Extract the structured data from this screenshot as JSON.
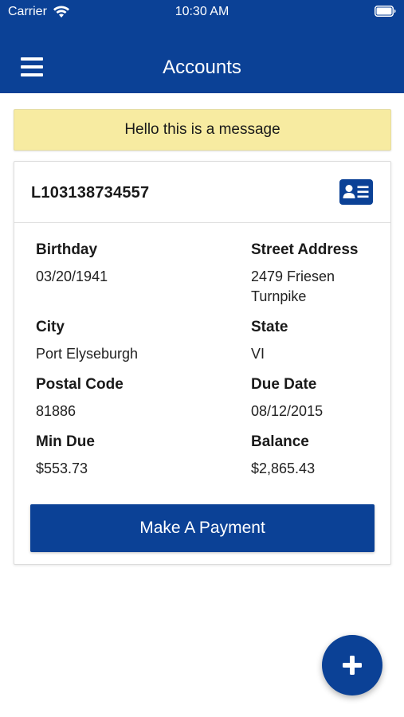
{
  "status_bar": {
    "carrier": "Carrier",
    "time": "10:30 AM",
    "wifi_icon": "wifi-icon",
    "battery_icon": "battery-icon"
  },
  "nav": {
    "title": "Accounts",
    "menu_icon": "hamburger-menu-icon"
  },
  "message": {
    "text": "Hello this is a message"
  },
  "account": {
    "id": "L103138734557",
    "card_icon": "id-card-icon",
    "fields": {
      "birthday": {
        "label": "Birthday",
        "value": "03/20/1941"
      },
      "street_address": {
        "label": "Street Address",
        "value": "2479 Friesen Turnpike"
      },
      "city": {
        "label": "City",
        "value": "Port Elyseburgh"
      },
      "state": {
        "label": "State",
        "value": "VI"
      },
      "postal_code": {
        "label": "Postal Code",
        "value": "81886"
      },
      "due_date": {
        "label": "Due Date",
        "value": "08/12/2015"
      },
      "min_due": {
        "label": "Min Due",
        "value": "$553.73"
      },
      "balance": {
        "label": "Balance",
        "value": "$2,865.43"
      }
    },
    "pay_button_label": "Make A Payment"
  },
  "fab": {
    "icon": "plus-icon"
  },
  "colors": {
    "primary": "#0b4196",
    "message_bg": "#f7eba1",
    "text": "#1a1a1a"
  }
}
